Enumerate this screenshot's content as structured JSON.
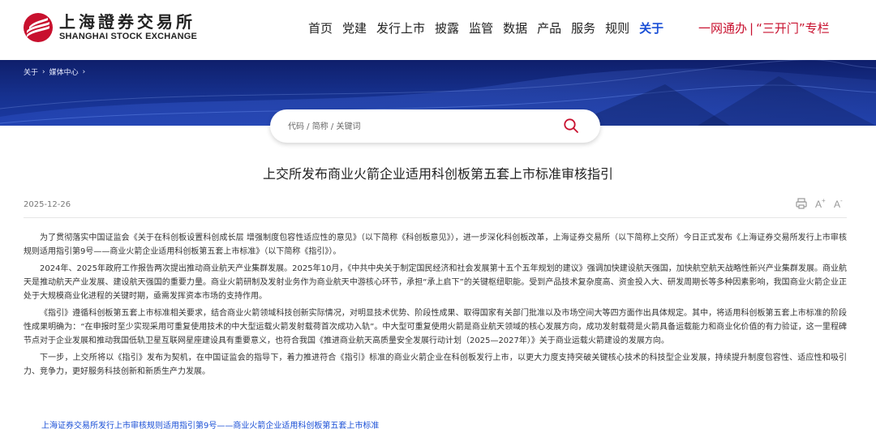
{
  "logo": {
    "cn": "上海證券交易所",
    "en": "SHANGHAI STOCK EXCHANGE"
  },
  "nav": {
    "items": [
      "首页",
      "党建",
      "发行上市",
      "披露",
      "监管",
      "数据",
      "产品",
      "服务",
      "规则",
      "关于"
    ],
    "active_index": 9
  },
  "special": {
    "item1": "一网通办",
    "sep": "|",
    "item2": "“三开门”专栏"
  },
  "breadcrumb": [
    "关于",
    "媒体中心"
  ],
  "search": {
    "placeholder": "代码 / 简称 / 关键词"
  },
  "article": {
    "title": "上交所发布商业火箭企业适用科创板第五套上市标准审核指引",
    "date": "2025-12-26",
    "tools": [
      "printer-icon",
      "font-increase-icon",
      "font-decrease-icon"
    ],
    "paragraphs": [
      "为了贯彻落实中国证监会《关于在科创板设置科创成长层 增强制度包容性适应性的意见》（以下简称《科创板意见》），进一步深化科创板改革，上海证券交易所（以下简称上交所）今日正式发布《上海证券交易所发行上市审核规则适用指引第9号——商业火箭企业适用科创板第五套上市标准》（以下简称《指引》）。",
      "2024年、2025年政府工作报告两次提出推动商业航天产业集群发展。2025年10月，《中共中央关于制定国民经济和社会发展第十五个五年规划的建议》强调加快建设航天强国，加快航空航天战略性新兴产业集群发展。商业航天是推动航天产业发展、建设航天强国的重要力量。商业火箭研制及发射业务作为商业航天中游核心环节，承担“承上启下”的关键枢纽职能。受到产品技术复杂度高、资金投入大、研发周期长等多种因素影响，我国商业火箭企业正处于大规模商业化进程的关键时期，亟需发挥资本市场的支持作用。",
      "《指引》遵循科创板第五套上市标准相关要求，结合商业火箭领域科技创新实际情况，对明显技术优势、阶段性成果、取得国家有关部门批准以及市场空间大等四方面作出具体规定。其中，将适用科创板第五套上市标准的阶段性成果明确为：“在申报时至少实现采用可重复使用技术的中大型运载火箭发射载荷首次成功入轨”。中大型可重复使用火箭是商业航天领域的核心发展方向，成功发射载荷是火箭具备运载能力和商业化价值的有力验证，这一里程碑节点对于企业发展和推动我国低轨卫星互联网星座建设具有重要意义，也符合我国《推进商业航天高质量安全发展行动计划（2025—2027年）》关于商业运载火箭建设的发展方向。",
      "下一步，上交所将以《指引》发布为契机，在中国证监会的指导下，着力推进符合《指引》标准的商业火箭企业在科创板发行上市，以更大力度支持突破关键核心技术的科技型企业发展，持续提升制度包容性、适应性和吸引力、竞争力，更好服务科技创新和新质生产力发展。"
    ],
    "attachment_link": "上海证券交易所发行上市审核规则适用指引第9号——商业火箭企业适用科创板第五套上市标准"
  },
  "colors": {
    "accent": "#1a4fd6",
    "brand_red": "#c8102e",
    "banner": "#16318f"
  }
}
